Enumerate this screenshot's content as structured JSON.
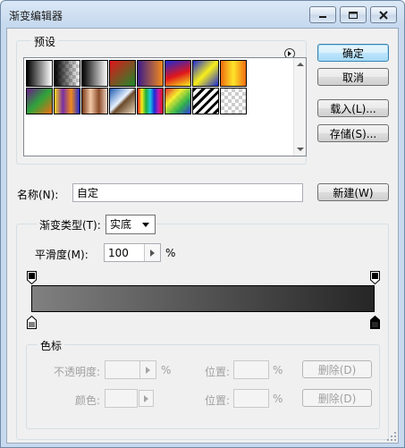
{
  "window": {
    "title": "渐变编辑器"
  },
  "presets": {
    "label": "预设",
    "swatches": [
      {
        "name": "swatch-foreground-to-background",
        "bg": "linear-gradient(to right, #000 0%, #fff 100%)"
      },
      {
        "name": "swatch-foreground-to-transparent",
        "bg": "linear-gradient(to right, #000 0%, rgba(0,0,0,0) 100%), repeating-conic-gradient(#ccc 0 25%, #fff 0 50%) 0 0/8px 8px"
      },
      {
        "name": "swatch-black-white",
        "bg": "linear-gradient(to right, #000, #fff)"
      },
      {
        "name": "swatch-red-green",
        "bg": "linear-gradient(135deg, #e0161b, #1f8a2b)"
      },
      {
        "name": "swatch-violet-orange",
        "bg": "linear-gradient(to right, #3a1b8a, #f28a1b)"
      },
      {
        "name": "swatch-blue-red-yellow",
        "bg": "linear-gradient(160deg, #1c2ad6 0%, #e0161b 55%, #f7ee1b 100%)"
      },
      {
        "name": "swatch-blue-yellow-blue",
        "bg": "linear-gradient(135deg, #1c2ad6 0%, #f7ee1b 50%, #1c2ad6 100%)"
      },
      {
        "name": "swatch-orange-yellow-orange",
        "bg": "linear-gradient(to right, #f06d10, #fde52a, #f06d10)"
      },
      {
        "name": "swatch-violet-green-orange",
        "bg": "linear-gradient(to bottom right, #6a1b8a, #2fa43a, #f06d10)"
      },
      {
        "name": "swatch-yellow-violet-orange-blue",
        "bg": "linear-gradient(to right, #f7d81b, #7a2fa4, #f08a1b, #1c2ad6)"
      },
      {
        "name": "swatch-copper",
        "bg": "linear-gradient(to right, #7a3a18, #f3c8a8, #8a4a28, #f3d8c8)"
      },
      {
        "name": "swatch-chrome",
        "bg": "linear-gradient(to bottom right, #1b5ab0 0%, #e8f2ff 45%, #6a4a2a 55%, #e8d8c0 100%)"
      },
      {
        "name": "swatch-spectrum",
        "bg": "linear-gradient(to right, #e0161b, #f7ee1b, #1fae3a, #1cc8e0, #1c2ad6, #c21ba8, #e0161b)"
      },
      {
        "name": "swatch-transparent-rainbow",
        "bg": "linear-gradient(135deg, rgba(224,22,27,.9), rgba(247,238,27,.9), rgba(31,174,58,.9), rgba(28,42,214,.9)), repeating-conic-gradient(#ccc 0 25%, #fff 0 50%) 0 0/8px 8px"
      },
      {
        "name": "swatch-transparent-stripes",
        "bg": "repeating-linear-gradient(135deg, #000 0 3px, #fff 3px 7px)"
      },
      {
        "name": "swatch-transparent",
        "bg": "repeating-conic-gradient(#ccc 0 25%, #fff 0 50%) 0 0/8px 8px"
      }
    ]
  },
  "buttons": {
    "ok": "确定",
    "cancel": "取消",
    "load": "载入(L)...",
    "save": "存储(S)...",
    "new": "新建(W)"
  },
  "name_field": {
    "label": "名称(N):",
    "value": "自定"
  },
  "gradient_type": {
    "label": "渐变类型(T):",
    "value": "实底"
  },
  "smoothness": {
    "label": "平滑度(M):",
    "value": "100",
    "unit": "%"
  },
  "gradient": {
    "start_color": "#808080",
    "end_color": "#262626"
  },
  "color_stops": {
    "label": "色标",
    "opacity_label": "不透明度:",
    "opacity_unit": "%",
    "location_label_1": "位置:",
    "location_unit_1": "%",
    "delete_1": "删除(D)",
    "color_label": "颜色:",
    "location_label_2": "位置:",
    "location_unit_2": "%",
    "delete_2": "删除(D)"
  }
}
